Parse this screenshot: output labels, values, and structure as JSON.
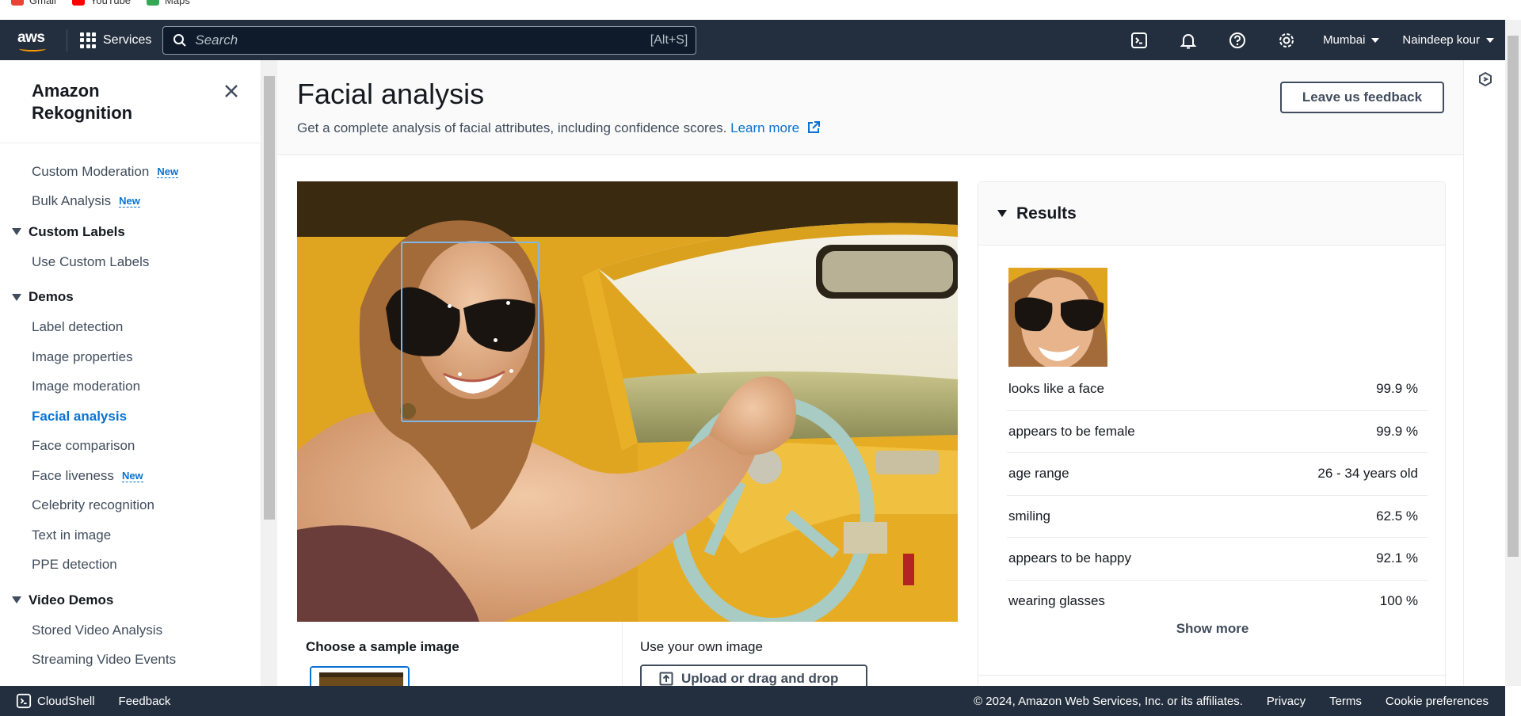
{
  "bookmarks": [
    {
      "label": "Gmail",
      "color": "#ea4335"
    },
    {
      "label": "YouTube",
      "color": "#ff0000"
    },
    {
      "label": "Maps",
      "color": "#34a853"
    }
  ],
  "topnav": {
    "logo": "aws",
    "services_label": "Services",
    "search_placeholder": "Search",
    "search_shortcut": "[Alt+S]",
    "icons": [
      "cloudshell-icon",
      "bell-icon",
      "help-icon",
      "gear-icon"
    ],
    "region": "Mumbai",
    "user": "Naindeep kour"
  },
  "sidebar": {
    "title": "Amazon Rekognition",
    "items_top": [
      {
        "label": "Custom Moderation",
        "badge": "New"
      },
      {
        "label": "Bulk Analysis",
        "badge": "New"
      }
    ],
    "custom_labels": {
      "title": "Custom Labels",
      "items": [
        "Use Custom Labels"
      ]
    },
    "demos": {
      "title": "Demos",
      "items": [
        {
          "label": "Label detection",
          "badge": ""
        },
        {
          "label": "Image properties",
          "badge": ""
        },
        {
          "label": "Image moderation",
          "badge": ""
        },
        {
          "label": "Facial analysis",
          "badge": "",
          "active": true
        },
        {
          "label": "Face comparison",
          "badge": ""
        },
        {
          "label": "Face liveness",
          "badge": "New"
        },
        {
          "label": "Celebrity recognition",
          "badge": ""
        },
        {
          "label": "Text in image",
          "badge": ""
        },
        {
          "label": "PPE detection",
          "badge": ""
        }
      ]
    },
    "video_demos": {
      "title": "Video Demos",
      "items": [
        "Stored Video Analysis",
        "Streaming Video Events"
      ]
    }
  },
  "header": {
    "title": "Facial analysis",
    "description": "Get a complete analysis of facial attributes, including confidence scores.",
    "learn_more": "Learn more",
    "feedback_button": "Leave us feedback"
  },
  "sample": {
    "choose_label": "Choose a sample image",
    "own_label": "Use your own image",
    "upload_button": "Upload or drag and drop"
  },
  "results": {
    "title": "Results",
    "attributes": [
      {
        "label": "looks like a face",
        "value": "99.9 %"
      },
      {
        "label": "appears to be female",
        "value": "99.9 %"
      },
      {
        "label": "age range",
        "value": "26 - 34 years old"
      },
      {
        "label": "smiling",
        "value": "62.5 %"
      },
      {
        "label": "appears to be happy",
        "value": "92.1 %"
      },
      {
        "label": "wearing glasses",
        "value": "100 %"
      }
    ],
    "show_more": "Show more"
  },
  "footer": {
    "cloudshell": "CloudShell",
    "feedback": "Feedback",
    "copyright": "© 2024, Amazon Web Services, Inc. or its affiliates.",
    "privacy": "Privacy",
    "terms": "Terms",
    "cookies": "Cookie preferences"
  }
}
